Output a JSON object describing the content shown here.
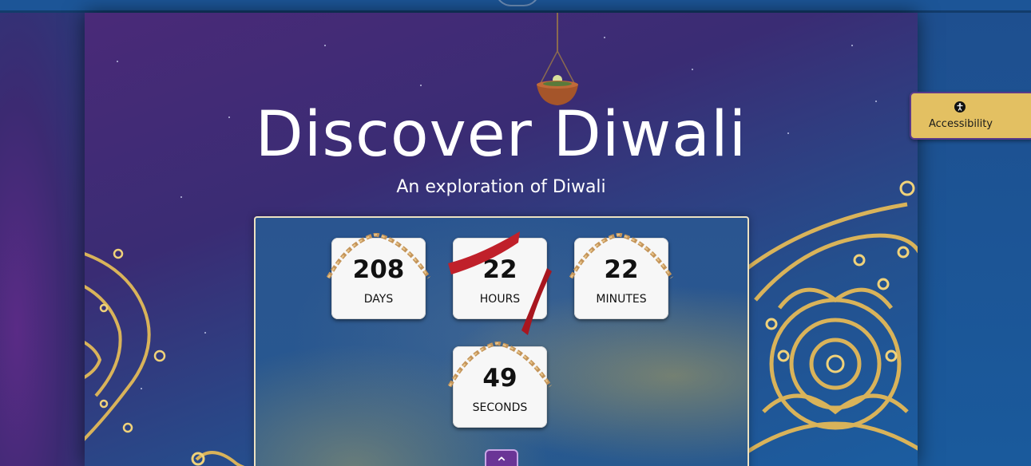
{
  "hero": {
    "title": "Discover Diwali",
    "subtitle": "An exploration of Diwali"
  },
  "countdown": {
    "units": [
      {
        "value": "208",
        "label": "DAYS"
      },
      {
        "value": "22",
        "label": "HOURS"
      },
      {
        "value": "22",
        "label": "MINUTES"
      },
      {
        "value": "49",
        "label": "SECONDS"
      }
    ]
  },
  "accessibility": {
    "label": "Accessibility",
    "icon": "accessibility-icon",
    "background": "#e3c062"
  },
  "scroll_up": {
    "icon": "chevron-up-icon",
    "glyph": "⌃"
  },
  "colors": {
    "accent_purple": "#6a3596",
    "gold": "#e3c062",
    "ribbon_red": "#c0202a"
  }
}
